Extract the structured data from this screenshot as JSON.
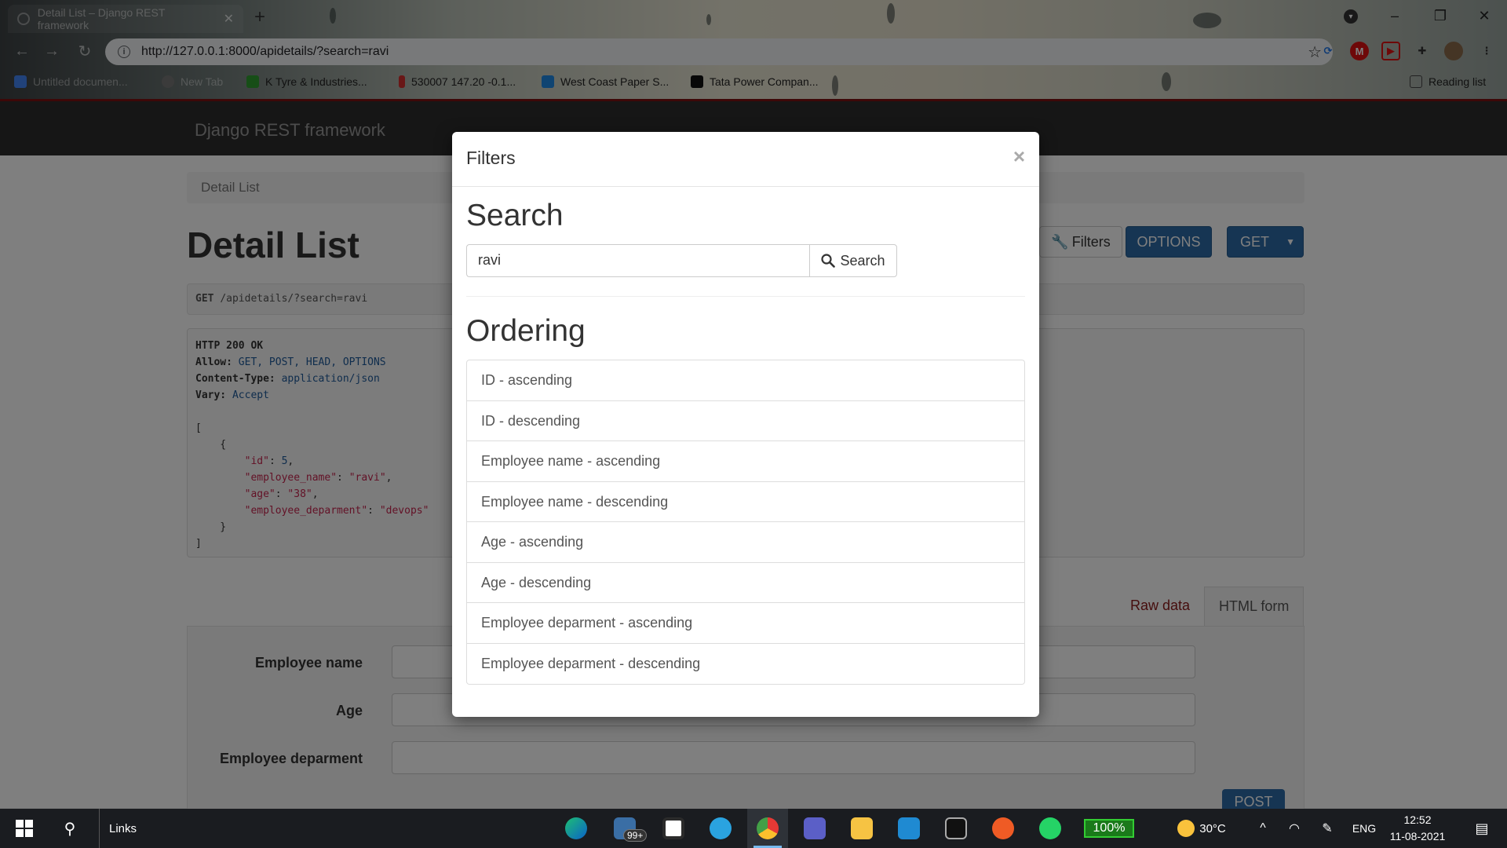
{
  "browser": {
    "tab_title": "Detail List – Django REST framework",
    "url": "http://127.0.0.1:8000/apidetails/?search=ravi",
    "bookmarks": [
      {
        "label": "Untitled documen...",
        "color": "#4285f4",
        "faded": true
      },
      {
        "label": "New Tab",
        "color": "#777777",
        "faded": true
      },
      {
        "label": "K Tyre & Industries...",
        "color": "#2e9d2e",
        "faded": false
      },
      {
        "label": "530007 147.20 -0.1...",
        "color": "#d32f2f",
        "faded": false
      },
      {
        "label": "West Coast Paper S...",
        "color": "#1e88e5",
        "faded": false
      },
      {
        "label": "Tata Power Compan...",
        "color": "#111111",
        "faded": false
      }
    ],
    "reading_list": "Reading list"
  },
  "page": {
    "brand": "Django REST framework",
    "breadcrumb": "Detail List",
    "title": "Detail List",
    "buttons": {
      "filters": "Filters",
      "options": "OPTIONS",
      "get": "GET"
    },
    "request": {
      "method": "GET",
      "path": "/apidetails/?search=ravi"
    },
    "response": {
      "status": "HTTP 200 OK",
      "allow_key": "Allow:",
      "allow_val": "GET, POST, HEAD, OPTIONS",
      "ctype_key": "Content-Type:",
      "ctype_val": "application/json",
      "vary_key": "Vary:",
      "vary_val": "Accept",
      "body": {
        "id": 5,
        "employee_name": "ravi",
        "age": "38",
        "employee_deparment": "devops"
      }
    },
    "tabs": {
      "raw": "Raw data",
      "html": "HTML form"
    },
    "form": {
      "fields": [
        "Employee name",
        "Age",
        "Employee deparment"
      ],
      "submit": "POST"
    }
  },
  "modal": {
    "title": "Filters",
    "close": "×",
    "search_heading": "Search",
    "search_value": "ravi",
    "search_button": "Search",
    "ordering_heading": "Ordering",
    "ordering": [
      "ID - ascending",
      "ID - descending",
      "Employee name - ascending",
      "Employee name - descending",
      "Age - ascending",
      "Age - descending",
      "Employee deparment - ascending",
      "Employee deparment - descending"
    ]
  },
  "taskbar": {
    "search_label": "Links",
    "mail_badge": "99+",
    "battery": "100%",
    "temperature": "30°C",
    "language": "ENG",
    "time": "12:52",
    "date": "11-08-2021"
  }
}
